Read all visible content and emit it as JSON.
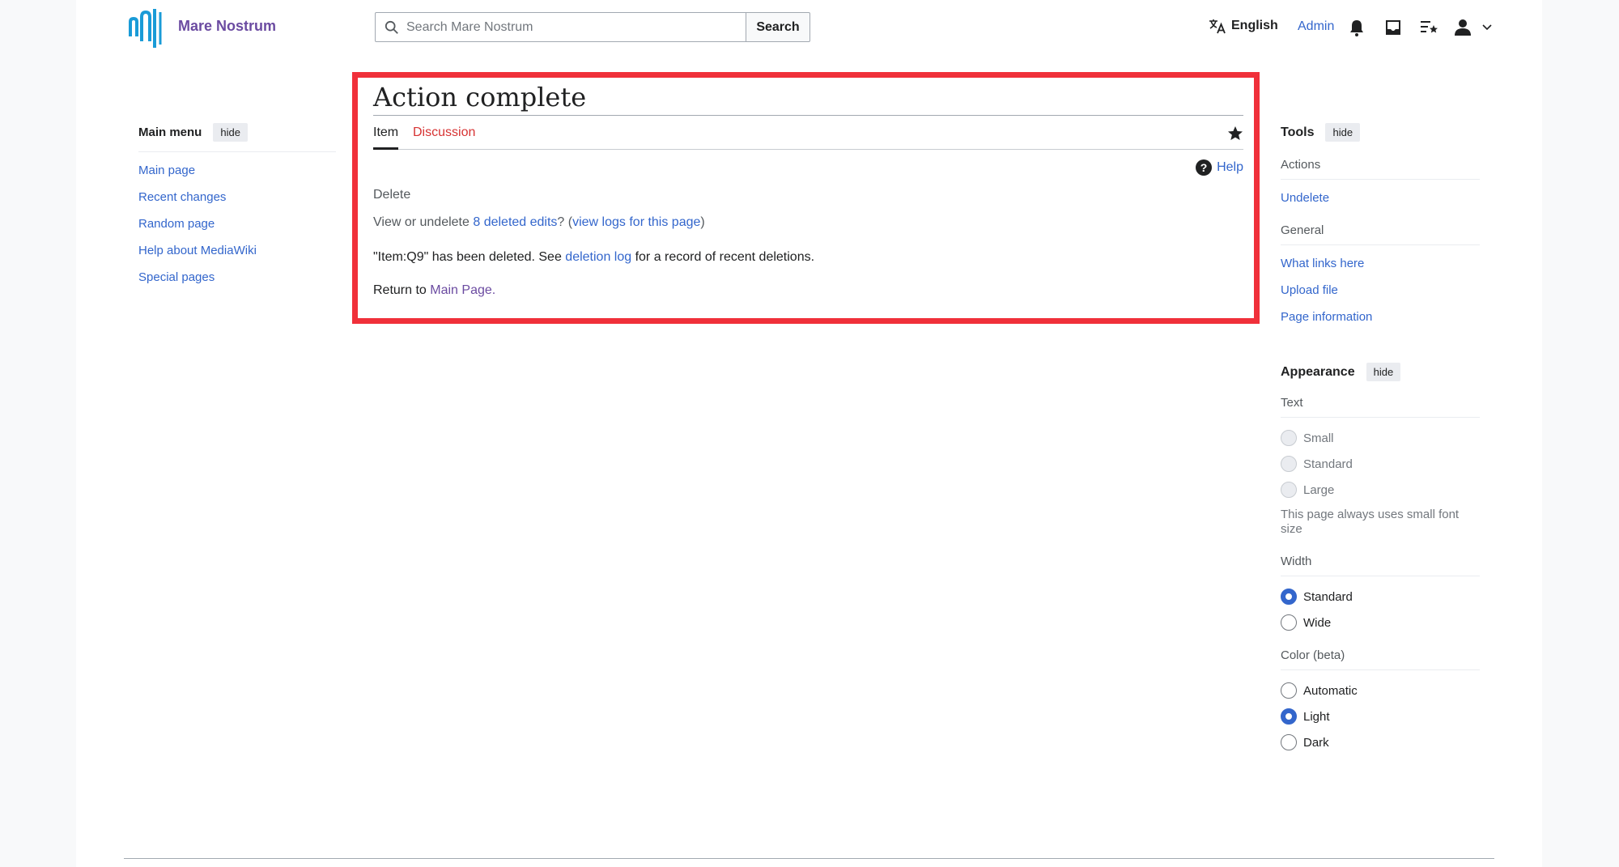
{
  "header": {
    "site_name": "Mare Nostrum",
    "search_placeholder": "Search Mare Nostrum",
    "search_button": "Search",
    "language": "English",
    "user": "Admin",
    "logo_color": "#1a9bd7"
  },
  "main_menu": {
    "title": "Main menu",
    "hide_label": "hide",
    "items": [
      "Main page",
      "Recent changes",
      "Random page",
      "Help about MediaWiki",
      "Special pages"
    ]
  },
  "content": {
    "title": "Action complete",
    "tabs": {
      "item": "Item",
      "discussion": "Discussion"
    },
    "help": "Help",
    "subtitle": "Delete",
    "line1": {
      "prefix": "View or undelete ",
      "deleted_edits": "8 deleted edits",
      "middle": "? (",
      "view_logs": "view logs for this page",
      "suffix": ")"
    },
    "line2": {
      "prefix": "\"Item:Q9\" has been deleted. See ",
      "deletion_log": "deletion log",
      "suffix": " for a record of recent deletions."
    },
    "line3": {
      "prefix": "Return to ",
      "main_page": "Main Page",
      "suffix": "."
    }
  },
  "tools": {
    "title": "Tools",
    "hide_label": "hide",
    "actions_label": "Actions",
    "undelete": "Undelete",
    "general_label": "General",
    "what_links_here": "What links here",
    "upload_file": "Upload file",
    "page_information": "Page information"
  },
  "appearance": {
    "title": "Appearance",
    "hide_label": "hide",
    "text_label": "Text",
    "text_options": [
      "Small",
      "Standard",
      "Large"
    ],
    "text_note": "This page always uses small font size",
    "width_label": "Width",
    "width_options": [
      "Standard",
      "Wide"
    ],
    "width_selected": "Standard",
    "color_label": "Color (beta)",
    "color_options": [
      "Automatic",
      "Light",
      "Dark"
    ],
    "color_selected": "Light"
  },
  "colors": {
    "link": "#3366cc",
    "visited": "#6b4ba1",
    "new_link": "#d73333",
    "highlight_box": "#f0303a"
  }
}
